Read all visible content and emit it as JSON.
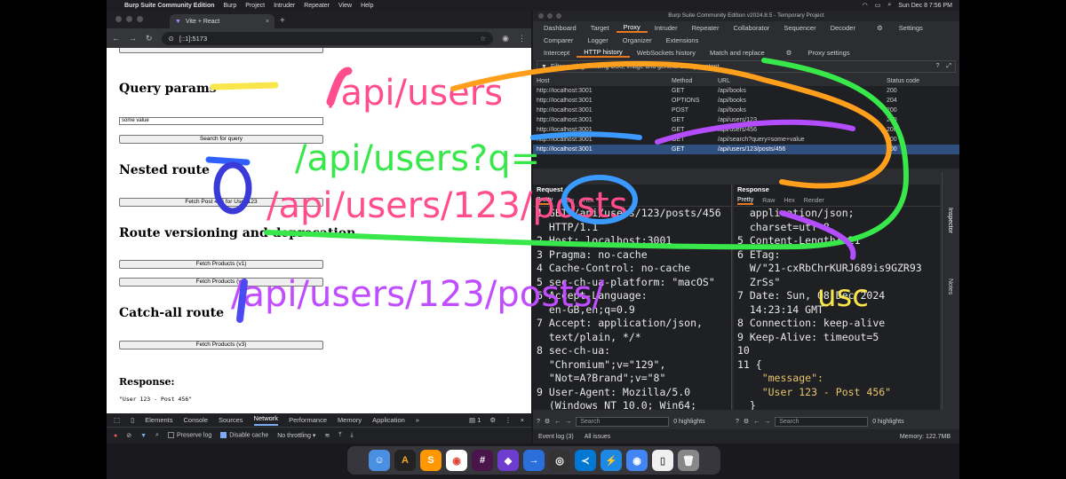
{
  "menubar": {
    "app_name": "Burp Suite Community Edition",
    "items": [
      "Burp",
      "Project",
      "Intruder",
      "Repeater",
      "View",
      "Help"
    ],
    "datetime": "Sun Dec 8  7:56 PM"
  },
  "chrome": {
    "tab_title": "Vite + React",
    "url": "[::1]:5173",
    "page": {
      "heading_query": "Query params",
      "query_input_value": "some value",
      "search_button": "Search for query",
      "heading_nested": "Nested route",
      "nested_button": "Fetch Post 456 for User 123",
      "heading_versioning": "Route versioning and deprecation",
      "products_v1": "Fetch Products (v1)",
      "products_v2": "Fetch Products (v2)",
      "heading_catchall": "Catch-all route",
      "products_v3": "Fetch Products (v3)",
      "response_heading": "Response:",
      "response_text": "\"User 123 - Post 456\""
    },
    "devtools": {
      "tabs": [
        "Elements",
        "Console",
        "Sources",
        "Network",
        "Performance",
        "Memory",
        "Application"
      ],
      "active_tab": "Network",
      "issues_count": "1",
      "preserve_log": "Preserve log",
      "disable_cache": "Disable cache",
      "throttling": "No throttling"
    }
  },
  "burp": {
    "title": "Burp Suite Community Edition v2024.8.5 - Temporary Project",
    "main_tabs": [
      "Dashboard",
      "Target",
      "Proxy",
      "Intruder",
      "Repeater",
      "Collaborator",
      "Sequencer",
      "Decoder",
      "Settings"
    ],
    "main_tabs_2": [
      "Comparer",
      "Logger",
      "Organizer",
      "Extensions"
    ],
    "active_tab": "Proxy",
    "proxy_tabs": [
      "Intercept",
      "HTTP history",
      "WebSockets history",
      "Match and replace",
      "Proxy settings"
    ],
    "active_proxy_tab": "HTTP history",
    "filter_text": "Filter settings: Hiding CSS, image and general binary content",
    "table_headers": [
      "Host",
      "Method",
      "URL",
      "Status code"
    ],
    "rows": [
      {
        "host": "http://localhost:3001",
        "method": "GET",
        "url": "/api/books",
        "status": "200"
      },
      {
        "host": "http://localhost:3001",
        "method": "OPTIONS",
        "url": "/api/books",
        "status": "204"
      },
      {
        "host": "http://localhost:3001",
        "method": "POST",
        "url": "/api/books",
        "status": "200"
      },
      {
        "host": "http://localhost:3001",
        "method": "GET",
        "url": "/api/users/123",
        "status": "200"
      },
      {
        "host": "http://localhost:3001",
        "method": "GET",
        "url": "/api/users/456",
        "status": "200"
      },
      {
        "host": "http://localhost:3001",
        "method": "GET",
        "url": "/api/search?query=some+value",
        "status": "200"
      },
      {
        "host": "http://localhost:3001",
        "method": "GET",
        "url": "/api/users/123/posts/456",
        "status": "200"
      }
    ],
    "request_title": "Request",
    "response_title": "Response",
    "pane_tabs": [
      "Pretty",
      "Raw",
      "Hex"
    ],
    "response_tabs": [
      "Pretty",
      "Raw",
      "Hex",
      "Render"
    ],
    "request_lines": [
      "1 GET /api/users/123/posts/456",
      "  HTTP/1.1",
      "2 Host: localhost:3001",
      "3 Pragma: no-cache",
      "4 Cache-Control: no-cache",
      "5 sec-ch-ua-platform: \"macOS\"",
      "6 Accept-Language:",
      "  en-GB,en;q=0.9",
      "7 Accept: application/json,",
      "  text/plain, */*",
      "8 sec-ch-ua:",
      "  \"Chromium\";v=\"129\",",
      "  \"Not=A?Brand\";v=\"8\"",
      "9 User-Agent: Mozilla/5.0",
      "  (Windows NT 10.0; Win64;"
    ],
    "response_lines": [
      "  application/json;",
      "  charset=utf-8",
      "5 Content-Length: 21",
      "6 ETag:",
      "  W/\"21-cxRbChrKURJ689is9GZR93",
      "  ZrSs\"",
      "7 Date: Sun, 08 Dec 2024",
      "  14:23:14 GMT",
      "8 Connection: keep-alive",
      "9 Keep-Alive: timeout=5",
      "10",
      "11 {",
      "    \"message\":",
      "    \"User 123 - Post 456\"",
      "  }"
    ],
    "search_placeholder": "Search",
    "highlights": "0 highlights",
    "inspector": "Inspector",
    "notes": "Notes",
    "event_log": "Event log (3)",
    "all_issues": "All issues",
    "memory": "Memory: 122.7MB"
  },
  "annotations": [
    "/api/users",
    "/api/users?q=",
    "/api/users/123/posts",
    "/api/users/123/posts/"
  ],
  "dock": [
    "Finder",
    "Arc",
    "Sublime",
    "Chrome",
    "Slack",
    "Obsidian",
    "Migrate",
    "Screen",
    "VS Code",
    "Fast",
    "Chrome",
    "Docs",
    "Trash"
  ]
}
